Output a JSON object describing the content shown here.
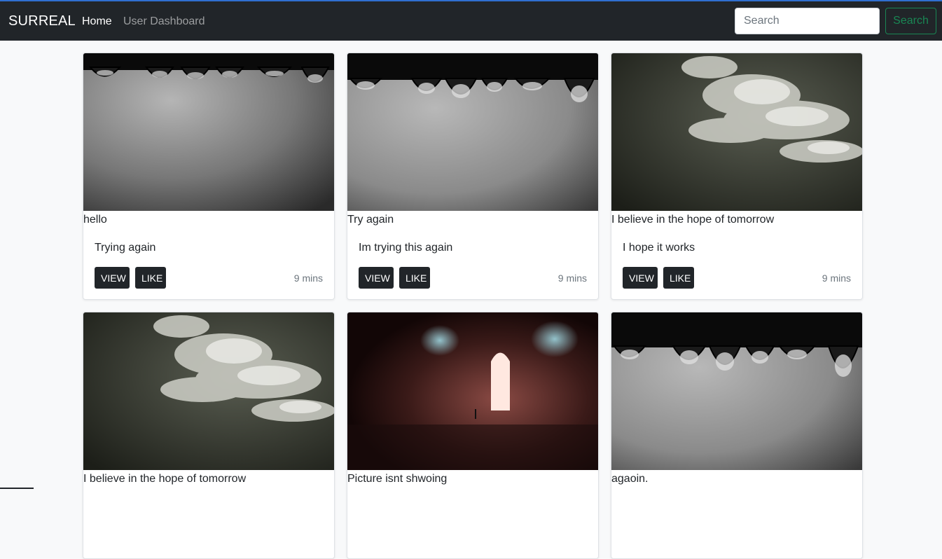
{
  "nav": {
    "brand": "SURREAL",
    "links": [
      "Home",
      "User Dashboard"
    ],
    "search_placeholder": "Search",
    "search_button": "Search"
  },
  "posts": [
    {
      "title": "hello",
      "text": "Trying again",
      "view": "VIEW",
      "like": "LIKE",
      "time": "9 mins",
      "image": "droplets"
    },
    {
      "title": "Try again",
      "text": "Im trying this again",
      "view": "VIEW",
      "like": "LIKE",
      "time": "9 mins",
      "image": "droplets"
    },
    {
      "title": "I believe in the hope of tomorrow",
      "text": "I hope it works",
      "view": "VIEW",
      "like": "LIKE",
      "time": "9 mins",
      "image": "clouds"
    },
    {
      "title": "I believe in the hope of tomorrow",
      "image": "clouds"
    },
    {
      "title": "Picture isnt shwoing",
      "image": "doorway"
    },
    {
      "title": "agaoin.",
      "image": "droplets"
    }
  ],
  "colors": {
    "navbar": "#212529",
    "page_bg": "#f8f9fa",
    "search_button": "#198754",
    "button_dark": "#212529",
    "muted_text": "#6c757d"
  }
}
